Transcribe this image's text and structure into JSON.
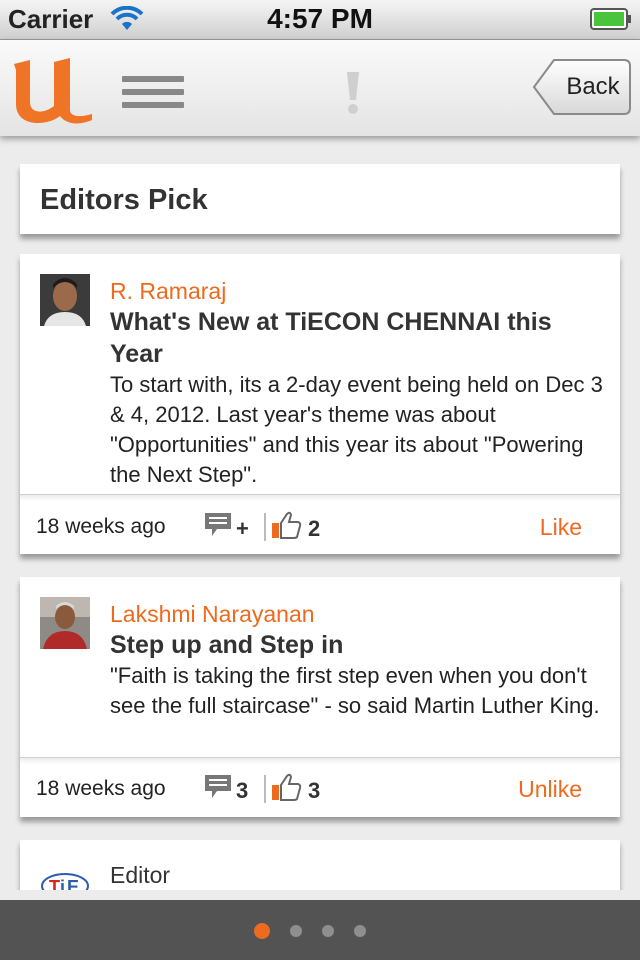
{
  "status_bar": {
    "carrier": "Carrier",
    "time": "4:57 PM"
  },
  "nav": {
    "logo_icon": "u-logo-icon",
    "menu_icon": "hamburger-menu-icon",
    "alert_icon": "exclamation-icon",
    "back_label": "Back"
  },
  "section": {
    "title": "Editors Pick"
  },
  "colors": {
    "accent": "#ee6a1e",
    "page_bar": "#535353",
    "background": "#ececec"
  },
  "posts": [
    {
      "author": "R. Ramaraj",
      "title": "What's New at TiECON CHENNAI this Year",
      "title_line1": "What's New at TiECON CHENNAI this",
      "title_line2": "Year",
      "body": "To start with, its a 2-day event being held on Dec 3 & 4, 2012. Last year's theme was about \"Opportunities\" and this year its about \"Powering the Next Step\".",
      "time_ago": "18 weeks ago",
      "comments": "+",
      "likes": "2",
      "like_action": "Like"
    },
    {
      "author": "Lakshmi Narayanan",
      "title": "Step up and Step in",
      "body": "\"Faith is taking the first step even when you don't see the full staircase\" - so said Martin Luther King.",
      "time_ago": "18 weeks ago",
      "comments": "3",
      "likes": "3",
      "like_action": "Unlike"
    },
    {
      "author": "Editor",
      "avatar_icon": "tie-logo-icon"
    }
  ],
  "page_control": {
    "pages": 4,
    "current": 1
  }
}
